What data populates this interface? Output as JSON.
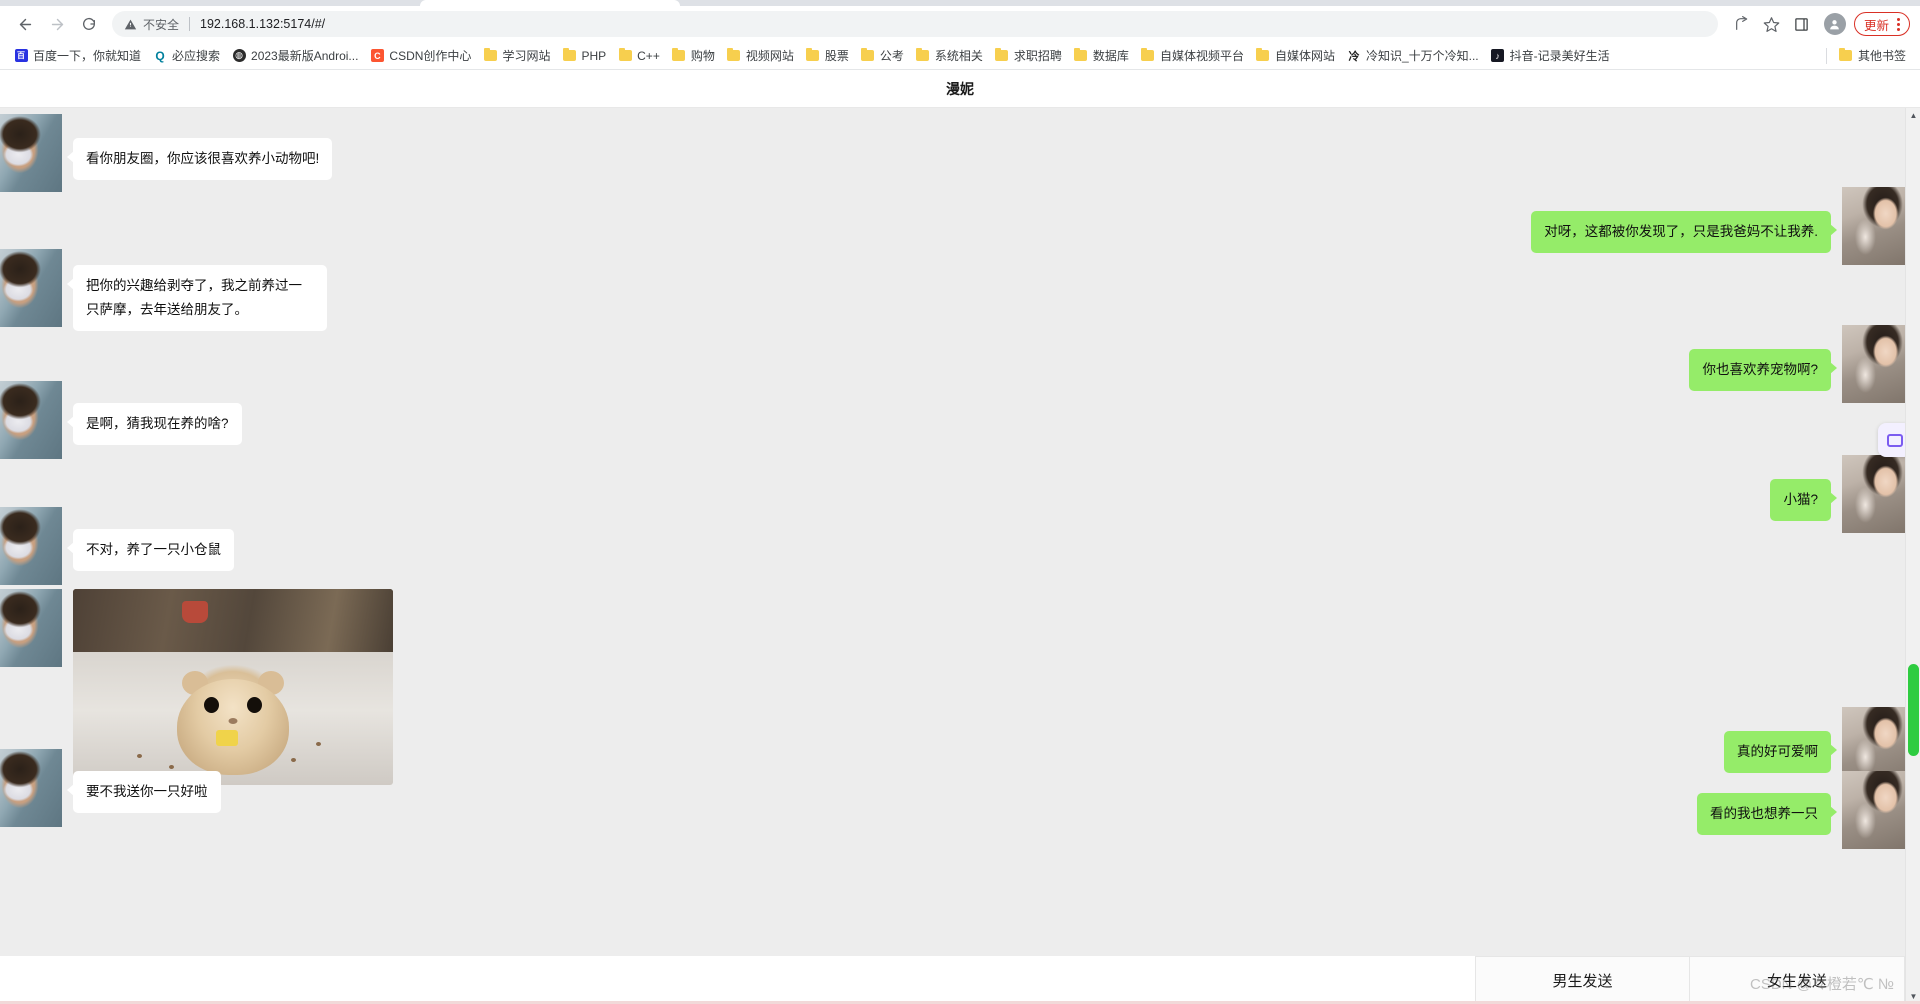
{
  "browser": {
    "nav": {
      "back_label": "←",
      "forward_label": "→",
      "reload_label": "⟳"
    },
    "omnibox": {
      "security_label": "不安全",
      "url": "192.168.1.132:5174/#/",
      "warning_icon": "warning-triangle-icon"
    },
    "toolbar_icons": {
      "share_label": "⤤",
      "bookmark_label": "☆",
      "sidepanel_label": "▣",
      "profile_label": "●"
    },
    "update_button_label": "更新",
    "menu_label": "⋮"
  },
  "bookmarks": {
    "items": [
      {
        "label": "百度一下，你就知道",
        "icon": "baidu-icon"
      },
      {
        "label": "必应搜索",
        "icon": "bing-icon"
      },
      {
        "label": "2023最新版Androi...",
        "icon": "globe-icon"
      },
      {
        "label": "CSDN创作中心",
        "icon": "csdn-icon"
      },
      {
        "label": "学习网站",
        "icon": "folder-icon"
      },
      {
        "label": "PHP",
        "icon": "folder-icon"
      },
      {
        "label": "C++",
        "icon": "folder-icon"
      },
      {
        "label": "购物",
        "icon": "folder-icon"
      },
      {
        "label": "视频网站",
        "icon": "folder-icon"
      },
      {
        "label": "股票",
        "icon": "folder-icon"
      },
      {
        "label": "公考",
        "icon": "folder-icon"
      },
      {
        "label": "系统相关",
        "icon": "folder-icon"
      },
      {
        "label": "求职招聘",
        "icon": "folder-icon"
      },
      {
        "label": "数据库",
        "icon": "folder-icon"
      },
      {
        "label": "自媒体视频平台",
        "icon": "folder-icon"
      },
      {
        "label": "自媒体网站",
        "icon": "folder-icon"
      },
      {
        "label": "冷知识_十万个冷知...",
        "icon": "cold-knowledge-icon"
      },
      {
        "label": "抖音-记录美好生活",
        "icon": "douyin-icon"
      }
    ],
    "other_bookmarks_label": "其他书签"
  },
  "chat": {
    "title": "漫妮",
    "messages": [
      {
        "side": "left",
        "type": "text",
        "text": "看你朋友圈，你应该很喜欢养小动物吧!"
      },
      {
        "side": "right",
        "type": "text",
        "text": "对呀，这都被你发现了，只是我爸妈不让我养."
      },
      {
        "side": "left",
        "type": "text",
        "text": "把你的兴趣给剥夺了，我之前养过一只萨摩，去年送给朋友了。"
      },
      {
        "side": "right",
        "type": "text",
        "text": "你也喜欢养宠物啊?"
      },
      {
        "side": "left",
        "type": "text",
        "text": "是啊，猜我现在养的啥?"
      },
      {
        "side": "right",
        "type": "text",
        "text": "小猫?"
      },
      {
        "side": "left",
        "type": "text",
        "text": "不对，养了一只小仓鼠"
      },
      {
        "side": "left",
        "type": "image",
        "alt": "hamster-photo"
      },
      {
        "side": "right",
        "type": "text",
        "text": "真的好可爱啊"
      },
      {
        "side": "right",
        "type": "text",
        "text": "看的我也想养一只"
      },
      {
        "side": "left",
        "type": "text",
        "text": "要不我送你一只好啦"
      }
    ]
  },
  "actions": {
    "male_send_label": "男生发送",
    "female_send_label": "女生发送"
  },
  "watermark": "CSDN @々橙若℃ №",
  "colors": {
    "outgoing_bubble": "#95ec69",
    "incoming_bubble": "#ffffff",
    "chat_background": "#ededed",
    "scrollbar_thumb": "#2ecc40",
    "update_accent": "#d93025"
  }
}
